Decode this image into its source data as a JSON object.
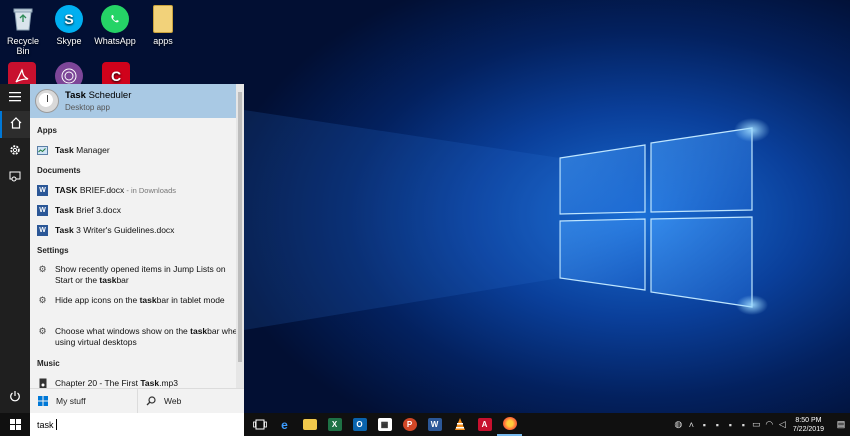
{
  "desktop": {
    "icons": [
      {
        "label": "Recycle Bin",
        "icon": "recycle-bin-icon"
      },
      {
        "label": "Skype",
        "icon": "skype-icon",
        "color": "#00aff0"
      },
      {
        "label": "WhatsApp",
        "icon": "whatsapp-icon",
        "color": "#25d366"
      },
      {
        "label": "apps",
        "icon": "folder-icon",
        "color": "#f2c94c"
      }
    ]
  },
  "search": {
    "best_match": {
      "bold": "Task",
      "rest": " Scheduler",
      "subtitle": "Desktop app"
    },
    "apps_header": "Apps",
    "apps": [
      {
        "bold": "Task",
        "rest": " Manager"
      }
    ],
    "documents_header": "Documents",
    "documents": [
      {
        "bold": "TASK",
        "rest": " BRIEF.docx",
        "suffix": " - in Downloads"
      },
      {
        "bold": "Task",
        "rest": " Brief 3.docx"
      },
      {
        "bold": "Task",
        "rest": " 3 Writer's Guidelines.docx"
      }
    ],
    "settings_header": "Settings",
    "settings": [
      {
        "before": "Show recently opened items in Jump Lists on Start or the ",
        "bold": "task",
        "after": "bar"
      },
      {
        "before": "Hide app icons on the ",
        "bold": "task",
        "after": "bar in tablet mode"
      },
      {
        "before": "Choose what windows show on the ",
        "bold": "task",
        "after": "bar when using virtual desktops"
      }
    ],
    "music_header": "Music",
    "music": [
      {
        "rest": "Chapter 20 - The First ",
        "bold": "Task",
        "after": ".mp3"
      }
    ],
    "filter_my_stuff": "My stuff",
    "filter_web": "Web",
    "query": "task"
  },
  "taskbar": {
    "time": "8:50 PM",
    "date": "7/22/2019"
  },
  "colors": {
    "accent": "#0078d7",
    "selection": "#a9c9e4"
  }
}
